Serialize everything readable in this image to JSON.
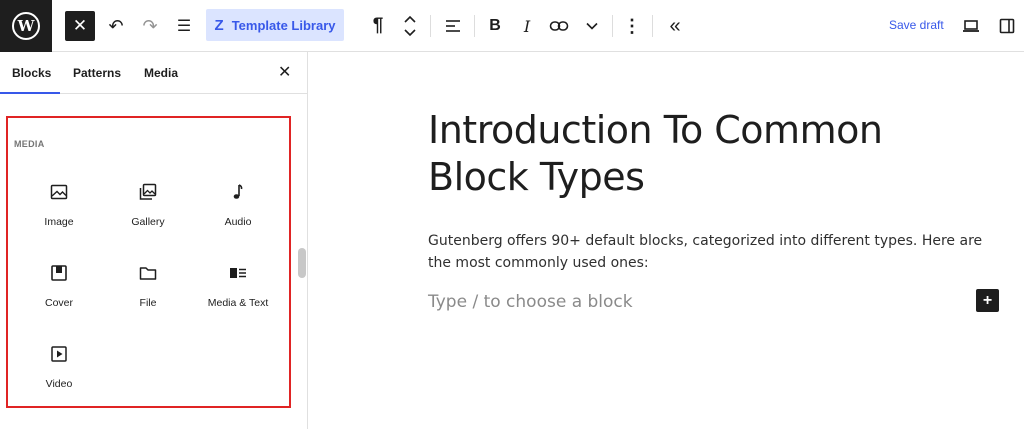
{
  "toolbar": {
    "logo_letter": "W",
    "close_glyph": "✕",
    "undo_glyph": "↶",
    "redo_glyph": "↷",
    "outline_glyph": "☰",
    "template_library_label": "Template Library",
    "template_library_icon_glyph": "Z",
    "paragraph_glyph": "¶",
    "bold_glyph": "B",
    "italic_glyph": "I",
    "link_glyph": "⊂⊃",
    "more_glyph": "⌄",
    "options_glyph": "⋮",
    "collapse_glyph": "«",
    "save_draft_label": "Save draft",
    "accent_color": "#3858e9"
  },
  "sidebar": {
    "tabs": [
      {
        "label": "Blocks",
        "active": true
      },
      {
        "label": "Patterns",
        "active": false
      },
      {
        "label": "Media",
        "active": false
      }
    ],
    "close_glyph": "✕",
    "category_label": "MEDIA",
    "blocks": [
      {
        "label": "Image",
        "icon": "image-icon"
      },
      {
        "label": "Gallery",
        "icon": "gallery-icon"
      },
      {
        "label": "Audio",
        "icon": "audio-icon"
      },
      {
        "label": "Cover",
        "icon": "cover-icon"
      },
      {
        "label": "File",
        "icon": "file-icon"
      },
      {
        "label": "Media & Text",
        "icon": "media-text-icon"
      },
      {
        "label": "Video",
        "icon": "video-icon"
      }
    ],
    "highlight_color": "#e02424"
  },
  "editor": {
    "title_line1": "Introduction To Common",
    "title_line2": "Block Types",
    "paragraph_line1": "Gutenberg offers 90+ default blocks, categorized into different types. Here are",
    "paragraph_line2": "the most commonly used ones:",
    "placeholder": "Type / to choose a block",
    "add_block_glyph": "+"
  }
}
